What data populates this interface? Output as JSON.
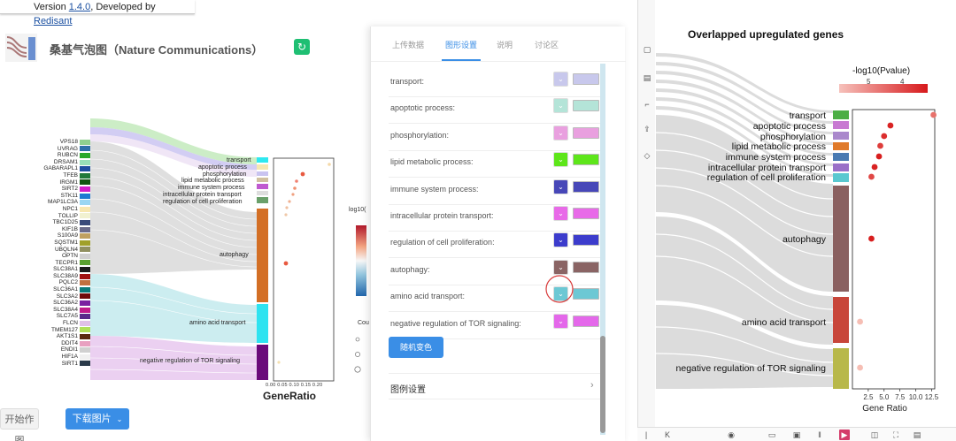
{
  "version": {
    "prefix": "Version ",
    "number": "1.4.0",
    "mid": ", Developed by ",
    "author": "Redisant"
  },
  "app_title": "桑基气泡图（Nature Communications）",
  "genes": [
    {
      "name": "VPS18",
      "color": "#8fcf8f"
    },
    {
      "name": "UVRAG",
      "color": "#2f6fa8"
    },
    {
      "name": "RUBCN",
      "color": "#2aa82a"
    },
    {
      "name": "DRSAM1",
      "color": "#98e0b8"
    },
    {
      "name": "GABARAPL1",
      "color": "#1f4f9f"
    },
    {
      "name": "TFEB",
      "color": "#227a3a"
    },
    {
      "name": "IRGM1",
      "color": "#115511"
    },
    {
      "name": "SIRT2",
      "color": "#d21fc8"
    },
    {
      "name": "STK11",
      "color": "#1e7ad2"
    },
    {
      "name": "MAP1LC3A",
      "color": "#9ad6f2"
    },
    {
      "name": "NPC1",
      "color": "#f7e7b0"
    },
    {
      "name": "TOLLIP",
      "color": "#f1f1d0"
    },
    {
      "name": "TBC1D25",
      "color": "#3a4a7a"
    },
    {
      "name": "KIF1B",
      "color": "#6a6a8a"
    },
    {
      "name": "S100A9",
      "color": "#c0a060"
    },
    {
      "name": "SQSTM1",
      "color": "#a0a02a"
    },
    {
      "name": "UBQLN4",
      "color": "#909060"
    },
    {
      "name": "OPTN",
      "color": "#d0d0d0"
    },
    {
      "name": "TECPR1",
      "color": "#5aa030"
    },
    {
      "name": "SLC38A1",
      "color": "#1b1b1b"
    },
    {
      "name": "SLC38A9",
      "color": "#a01010"
    },
    {
      "name": "PQLC2",
      "color": "#c07040"
    },
    {
      "name": "SLC36A1",
      "color": "#0a7a7a"
    },
    {
      "name": "SLC3A2",
      "color": "#700a0a"
    },
    {
      "name": "SLC36A2",
      "color": "#7a20a0"
    },
    {
      "name": "SLC38A4",
      "color": "#c01a8a"
    },
    {
      "name": "SLC7A5",
      "color": "#5a2a8a"
    },
    {
      "name": "FLCN",
      "color": "#e0c0e8"
    },
    {
      "name": "TMEM127",
      "color": "#b0e05a"
    },
    {
      "name": "AKT1S1",
      "color": "#5a2a10"
    },
    {
      "name": "DDIT4",
      "color": "#e8a0c0"
    },
    {
      "name": "ENDI1",
      "color": "#d0d0d0"
    },
    {
      "name": "HIF1A",
      "color": "#f0f0f0"
    },
    {
      "name": "SIRT1",
      "color": "#2a3a4a"
    }
  ],
  "left_terms": {
    "transport": "transport",
    "apoptotic": "apoptotic process",
    "phosph": "phosphorylation",
    "lipid": "lipid metabolic process",
    "immune": "immune system process",
    "intra": "intracellular protein transport",
    "regcp": "regulation of cell proliferation",
    "autophagy": "autophagy",
    "aminoacid": "amino acid transport",
    "negtor": "negative regulation of TOR signaling"
  },
  "left_axis": {
    "xlabel": "GeneRatio",
    "ticks": "0.00 0.05 0.10 0.15 0.20",
    "legend_title": "log10(",
    "count_title": "Cou"
  },
  "bottom_buttons": {
    "draw": "开始作图",
    "download": "下载图片"
  },
  "panel": {
    "tabs": [
      "上传数据",
      "图形设置",
      "说明",
      "讨论区"
    ],
    "items": [
      {
        "label": "transport:",
        "color": "#c8c8ec"
      },
      {
        "label": "apoptotic process:",
        "color": "#b4e4d8"
      },
      {
        "label": "phosphorylation:",
        "color": "#e9a0df"
      },
      {
        "label": "lipid metabolic process:",
        "color": "#5ee61a"
      },
      {
        "label": "immune system process:",
        "color": "#4747b8"
      },
      {
        "label": "intracellular protein transport:",
        "color": "#e86ae8"
      },
      {
        "label": "regulation of cell proliferation:",
        "color": "#3c3ccc"
      },
      {
        "label": "autophagy:",
        "color": "#8a6464"
      },
      {
        "label": "amino acid transport:",
        "color": "#6cc8d4"
      },
      {
        "label": "negative regulation of TOR signaling:",
        "color": "#e468ea"
      }
    ],
    "apply_label": "随机变色",
    "legend_settings": "图例设置"
  },
  "right_chart": {
    "title": "Overlapped upregulated genes",
    "legend_title": "-log10(Pvalue)",
    "legend_ticks": [
      "5",
      "4"
    ],
    "xlabel": "Gene Ratio",
    "xticks": [
      "2.5",
      "5.0",
      "7.5",
      "10.0",
      "12.5"
    ]
  },
  "chart_data": {
    "type": "scatter",
    "title": "Overlapped upregulated genes",
    "xlabel": "Gene Ratio",
    "categories": [
      "transport",
      "apoptotic process",
      "phosphorylation",
      "lipid metabolic process",
      "immune system process",
      "intracellular protein transport",
      "regulation of cell proliferation",
      "autophagy",
      "amino acid transport",
      "negative regulation of TOR signaling"
    ],
    "category_colors": [
      "#4cae45",
      "#c87ad2",
      "#aa88cc",
      "#e07a2a",
      "#4a7ab2",
      "#9a70c8",
      "#5ac8d0",
      "#8a6060",
      "#c8463a",
      "#b8b84a"
    ],
    "x": [
      12.8,
      6.0,
      5.0,
      4.4,
      4.2,
      3.5,
      3.0,
      3.0,
      1.2,
      1.2
    ],
    "neglog10p": [
      4.0,
      5.5,
      5.3,
      5.0,
      5.6,
      5.5,
      4.8,
      5.6,
      2.5,
      2.5
    ],
    "xlim": [
      0,
      13
    ],
    "xticks": [
      2.5,
      5.0,
      7.5,
      10.0,
      12.5
    ]
  }
}
